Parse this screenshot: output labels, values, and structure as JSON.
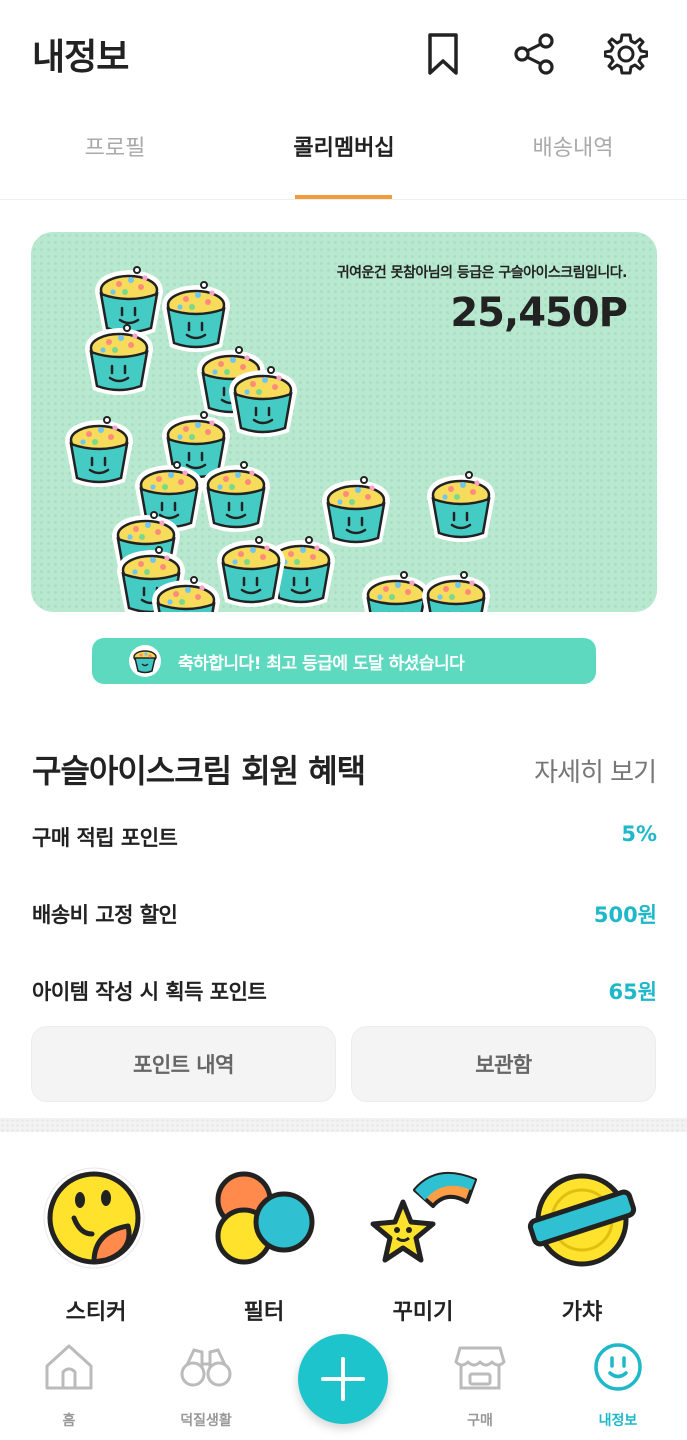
{
  "header": {
    "title": "내정보",
    "icons": [
      "bookmark-icon",
      "share-icon",
      "gear-icon"
    ]
  },
  "tabs": [
    {
      "label": "프로필",
      "active": false
    },
    {
      "label": "콜리멤버십",
      "active": true
    },
    {
      "label": "배송내역",
      "active": false
    }
  ],
  "banner": {
    "grade_text": "귀여운건 못참아님의 등급은 구슬아이스크림입니다.",
    "points": "25,450P"
  },
  "congrats": {
    "text": "축하합니다! 최고 등급에 도달 하셨습니다"
  },
  "benefits": {
    "title": "구슬아이스크림 회원 혜택",
    "more": "자세히 보기",
    "rows": [
      {
        "label": "구매 적립 포인트",
        "value": "5%"
      },
      {
        "label": "배송비 고정 할인",
        "value": "500원"
      },
      {
        "label": "아이템 작성 시 획득 포인트",
        "value": "65원"
      }
    ]
  },
  "buttons": {
    "points_history": "포인트 내역",
    "storage": "보관함"
  },
  "features": [
    {
      "label": "스티커",
      "icon": "sticker-icon"
    },
    {
      "label": "필터",
      "icon": "filter-icon"
    },
    {
      "label": "꾸미기",
      "icon": "decorate-star-icon"
    },
    {
      "label": "가챠",
      "icon": "gacha-capsule-icon"
    }
  ],
  "bottom_nav": [
    {
      "label": "홈",
      "icon": "home-icon"
    },
    {
      "label": "덕질생활",
      "icon": "binoculars-icon"
    },
    {
      "label": "",
      "icon": "plus-icon"
    },
    {
      "label": "구매",
      "icon": "store-icon"
    },
    {
      "label": "내정보",
      "icon": "smile-face-icon",
      "active": true
    }
  ],
  "colors": {
    "accent": "#1eb8c9",
    "tab_underline": "#f29b3a",
    "banner_bg": "#b8e8cf",
    "congrats_bg": "#5dd9c0",
    "fab": "#1ec4cc"
  }
}
